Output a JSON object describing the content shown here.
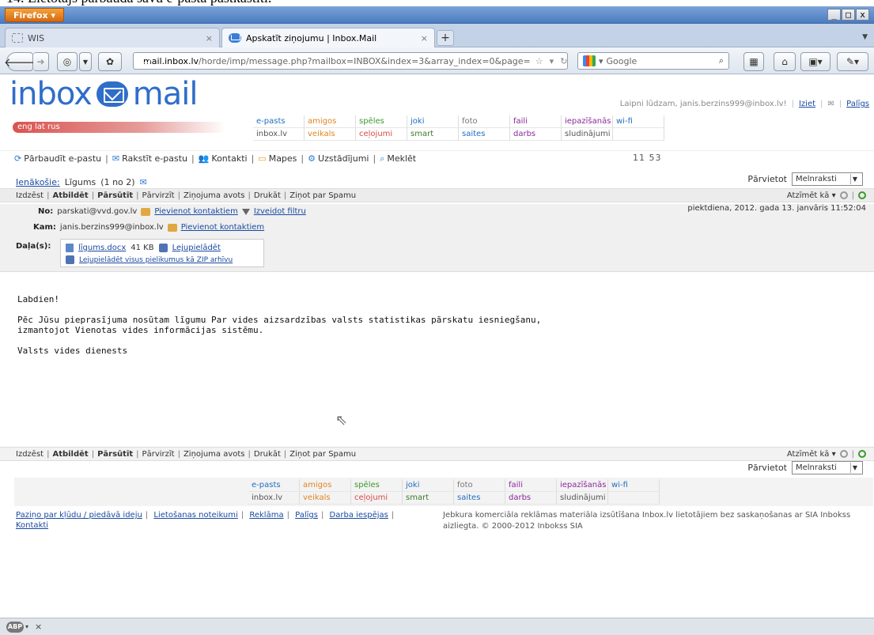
{
  "caption": "14. Lietotājs pārbauda savu e-pasta pastkastīti.",
  "window": {
    "app_button": "Firefox ▾",
    "minimize": "_",
    "maximize": "□",
    "close": "x"
  },
  "tabs": [
    {
      "label": "WIS",
      "close": "×"
    },
    {
      "label": "Apskatīt ziņojumu | Inbox.Mail",
      "close": "×"
    }
  ],
  "new_tab": "+",
  "nav": {
    "url_domain": "mail.inbox.lv",
    "url_path": "/horde/imp/message.php?mailbox=INBOX&index=3&array_index=0&page=",
    "search_placeholder": "Google"
  },
  "site": {
    "logo_left": "inbox",
    "logo_right": "mail",
    "welcome": "Laipni lūdzam, janis.berzins999@inbox.lv!",
    "logout": "Iziet",
    "help": "Palīgs",
    "lang": "eng  lat  rus"
  },
  "top_menu": {
    "row1": [
      "e-pasts",
      "amigos",
      "spēles",
      "joki",
      "foto",
      "faili",
      "iepazīšanās",
      "wi-fi"
    ],
    "row2": [
      "inbox.lv",
      "veikals",
      "ceļojumi",
      "smart",
      "saites",
      "darbs",
      "sludinājumi",
      ""
    ]
  },
  "toolbar": {
    "items": [
      "Pārbaudīt e-pastu",
      "Rakstīt e-pastu",
      "Kontakti",
      "Mapes",
      "Uzstādījumi",
      "Meklēt"
    ],
    "time": "11 53"
  },
  "message_nav": {
    "folder": "Ienākošie:",
    "subject": "Līgums",
    "counter": "(1 no 2)",
    "move_label": "Pārvietot",
    "move_value": "Melnraksti"
  },
  "actions": {
    "delete": "Izdzēst",
    "reply": "Atbildēt",
    "forward": "Pārsūtīt",
    "move": "Pārvirzīt",
    "source": "Ziņojuma avots",
    "print": "Drukāt",
    "spam": "Ziņot par Spamu",
    "mark_as": "Atzīmēt kā ▾"
  },
  "headers": {
    "from_label": "No:",
    "from_value": "parskati@vvd.gov.lv",
    "add_contact": "Pievienot kontaktiem",
    "create_filter": "Izveidot filtru",
    "date": "piektdiena, 2012. gada 13. janvāris 11:52:04",
    "to_label": "Kam:",
    "to_value": "janis.berzins999@inbox.lv",
    "parts_label": "Daļa(s):",
    "attachment_name": "līgums.docx",
    "attachment_size": "41 KB",
    "download": "Lejupielādēt",
    "download_all": "Lejupielādēt visus pielikumus kā ZIP arhīvu"
  },
  "body": {
    "greeting": "Labdien!",
    "text": "Pēc Jūsu pieprasījuma nosūtam līgumu Par vides aizsardzības valsts statistikas pārskatu iesniegšanu,\nizmantojot Vienotas vides informācijas sistēmu.",
    "signature": "Valsts vides dienests"
  },
  "footer": {
    "links": [
      "Paziņo par kļūdu / piedāvā ideju",
      "Lietošanas noteikumi",
      "Reklāma",
      "Palīgs",
      "Darba iespējas",
      "Kontakti"
    ],
    "legal": "Jebkura komerciāla reklāmas materiāla izsūtīšana Inbox.lv lietotājiem bez saskaņošanas ar SIA Inbokss aizliegta. © 2000-2012 Inbokss SIA"
  },
  "status": {
    "abp": "ABP",
    "close": "×"
  }
}
